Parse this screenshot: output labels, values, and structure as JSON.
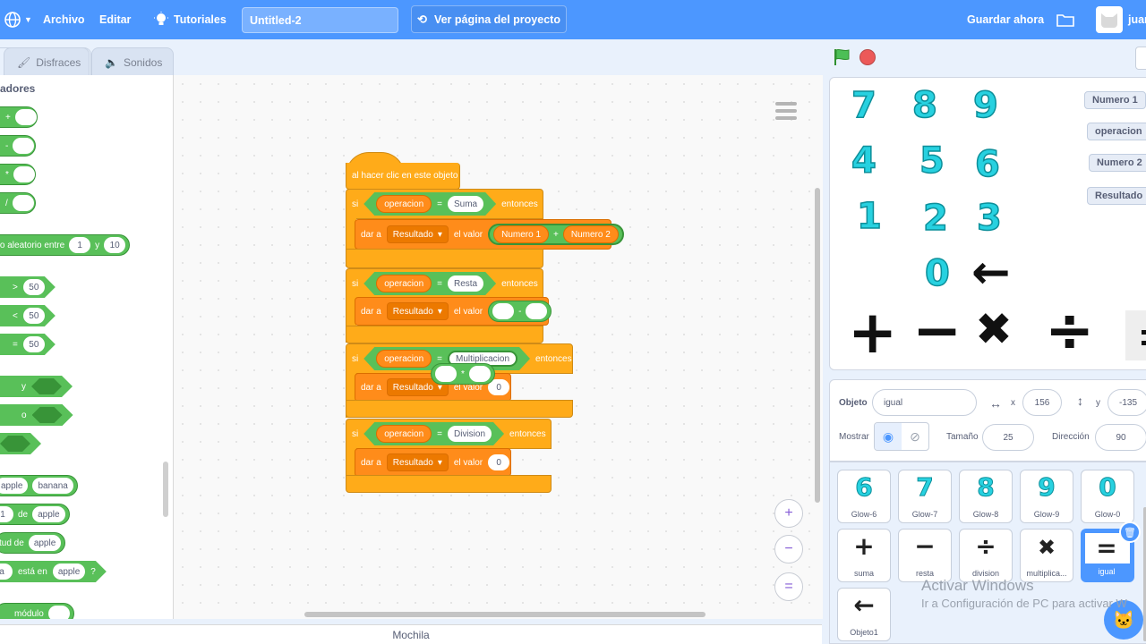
{
  "menu": {
    "archivo": "Archivo",
    "editar": "Editar",
    "tutoriales": "Tutoriales",
    "project_title": "Untitled-2",
    "ver_proyecto": "Ver página del proyecto",
    "guardar": "Guardar ahora",
    "user": "juan"
  },
  "tabs": {
    "disfraces": "Disfraces",
    "sonidos": "Sonidos"
  },
  "palette": {
    "heading": "adores",
    "plus": "+",
    "minus": "-",
    "times": "*",
    "div": "/",
    "random": {
      "label": "ero aleatorio entre",
      "a": "1",
      "and": "y",
      "b": "10"
    },
    "gt": {
      "op": ">",
      "val": "50"
    },
    "lt": {
      "op": "<",
      "val": "50"
    },
    "eq": {
      "op": "=",
      "val": "50"
    },
    "and": "y",
    "or": "o",
    "join": {
      "a": "apple",
      "b": "banana"
    },
    "letter": {
      "n": "1",
      "de": "de",
      "w": "apple"
    },
    "length": {
      "label": "tud de",
      "w": "apple"
    },
    "contains": {
      "a": "a",
      "label": "está en",
      "w": "apple",
      "q": "?"
    },
    "mod": "módulo"
  },
  "script": {
    "hat": "al hacer clic en este objeto",
    "si": "si",
    "entonces": "entonces",
    "dar": "dar a",
    "valor": "el valor",
    "var_op": "operacion",
    "var_res": "Resultado",
    "eq": "=",
    "n1": "Numero 1",
    "n2": "Numero 2",
    "plus": "+",
    "minus": "-",
    "times": "*",
    "suma": "Suma",
    "resta": "Resta",
    "mult": "Multiplicacion",
    "division": "Division",
    "zero": "0"
  },
  "workspace": {
    "zoom_in": "+",
    "zoom_out": "−",
    "reset": "="
  },
  "bottom": {
    "mochila": "Mochila"
  },
  "stage": {
    "digits": [
      "7",
      "8",
      "9",
      "4",
      "5",
      "6",
      "1",
      "2",
      "3",
      "0"
    ],
    "arrow": "←",
    "plus": "+",
    "minus": "−",
    "times": "✖",
    "divide": "÷",
    "variables": [
      "Numero 1",
      "operacion",
      "Numero 2",
      "Resultado"
    ]
  },
  "sprite_info": {
    "objeto_label": "Objeto",
    "objeto_value": "igual",
    "x_label": "x",
    "x": "156",
    "y_label": "y",
    "y": "-135",
    "mostrar": "Mostrar",
    "tamano_label": "Tamaño",
    "tamano": "25",
    "direccion_label": "Dirección",
    "direccion": "90"
  },
  "sprites": [
    {
      "glyph": "6",
      "name": "Glow-6"
    },
    {
      "glyph": "7",
      "name": "Glow-7"
    },
    {
      "glyph": "8",
      "name": "Glow-8"
    },
    {
      "glyph": "9",
      "name": "Glow-9"
    },
    {
      "glyph": "0",
      "name": "Glow-0"
    },
    {
      "glyph": "+",
      "name": "suma"
    },
    {
      "glyph": "−",
      "name": "resta"
    },
    {
      "glyph": "÷",
      "name": "division"
    },
    {
      "glyph": "✖",
      "name": "multiplica..."
    },
    {
      "glyph": "=",
      "name": "igual"
    },
    {
      "glyph": "←",
      "name": "Objeto1"
    }
  ],
  "watermark": {
    "line1": "Activar Windows",
    "line2": "Ir a Configuración de PC para activar W"
  },
  "colors": {
    "accent": "#4c97ff",
    "control": "#ffab19",
    "operators": "#59c059",
    "variables": "#ff8c1a"
  }
}
